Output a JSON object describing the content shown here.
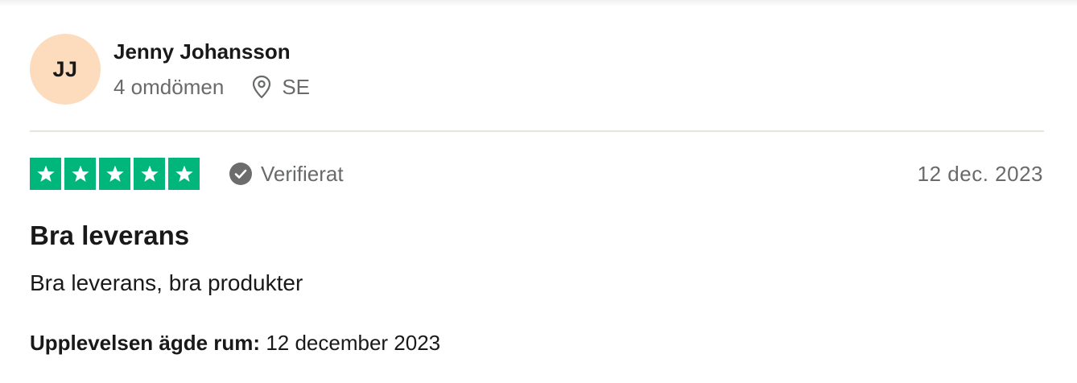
{
  "reviewer": {
    "initials": "JJ",
    "name": "Jenny Johansson",
    "review_count": "4 omdömen",
    "country": "SE",
    "avatar_color": "#fcdcbd"
  },
  "rating": {
    "stars": 5,
    "max_stars": 5,
    "star_color": "#00b67a",
    "icons": [
      "star-icon",
      "star-icon",
      "star-icon",
      "star-icon",
      "star-icon"
    ]
  },
  "verified": {
    "label": "Verifierat",
    "icon": "check-circle-icon"
  },
  "review": {
    "date": "12 dec. 2023",
    "title": "Bra leverans",
    "body": "Bra leverans, bra produkter",
    "experience_label": "Upplevelsen ägde rum:",
    "experience_date": "12 december 2023"
  },
  "icons": {
    "location": "location-pin-icon"
  }
}
